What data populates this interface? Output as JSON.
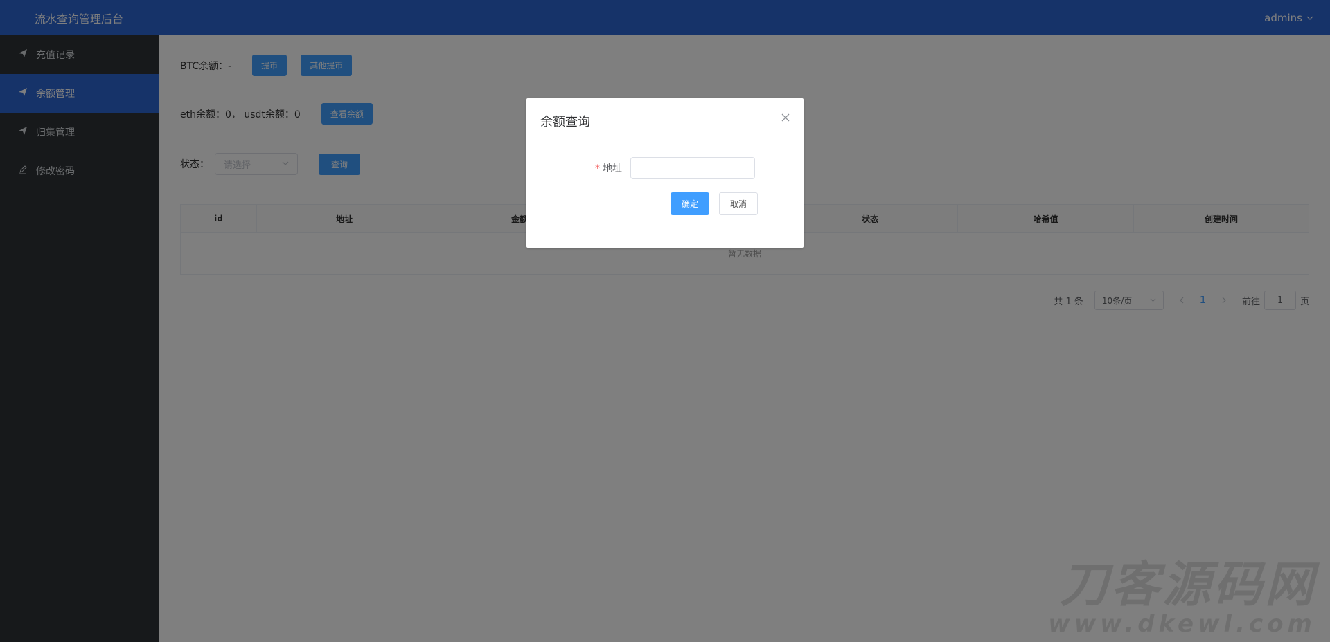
{
  "app": {
    "title": "流水查询管理后台",
    "user": "admins"
  },
  "sidebar": {
    "items": [
      {
        "label": "充值记录",
        "active": false
      },
      {
        "label": "余额管理",
        "active": true
      },
      {
        "label": "归集管理",
        "active": false
      },
      {
        "label": "修改密码",
        "active": false
      }
    ]
  },
  "main": {
    "btc": {
      "label": "BTC余额：-",
      "withdraw": "提币",
      "other_withdraw": "其他提币"
    },
    "eth": {
      "label": "eth余额：0， usdt余额：0",
      "check": "查看余额"
    },
    "filter": {
      "label": "状态：",
      "placeholder": "请选择",
      "query": "查询"
    },
    "table": {
      "columns": [
        "id",
        "地址",
        "金额",
        "",
        "状态",
        "哈希值",
        "创建时间"
      ],
      "empty": "暂无数据"
    },
    "pagination": {
      "total": "共 1 条",
      "page_size": "10条/页",
      "current": "1",
      "goto_label": "前往",
      "goto_value": "1",
      "goto_suffix": "页"
    }
  },
  "dialog": {
    "title": "余额查询",
    "field_label": "地址",
    "field_required": "*",
    "confirm": "确定",
    "cancel": "取消"
  },
  "watermark": {
    "line1": "刀客源码网",
    "line2": "www.dkewl.com"
  },
  "colors": {
    "primary": "#409eff",
    "header": "#2d66d2",
    "sidebar": "#2f3337"
  }
}
